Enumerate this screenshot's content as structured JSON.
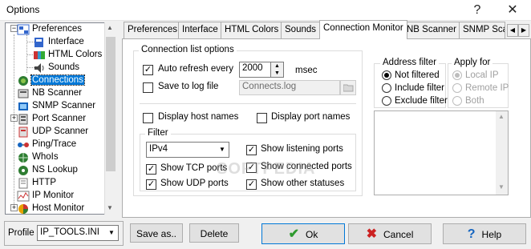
{
  "window": {
    "title": "Options",
    "help_glyph": "?",
    "close_glyph": "✕"
  },
  "tree": {
    "items": [
      {
        "label": "Preferences",
        "icon": "preferences-icon",
        "icon_color": "#3366cc"
      },
      {
        "label": "Interface",
        "icon": "interface-icon",
        "icon_color": "#3366cc"
      },
      {
        "label": "HTML Colors",
        "icon": "html-colors-icon",
        "icon_color": "#cc3333"
      },
      {
        "label": "Sounds",
        "icon": "sounds-icon",
        "icon_color": "#444444"
      },
      {
        "label": "Connections",
        "icon": "connections-icon",
        "icon_color": "#2e7d32"
      },
      {
        "label": "NB Scanner",
        "icon": "nb-scanner-icon",
        "icon_color": "#555555"
      },
      {
        "label": "SNMP Scanner",
        "icon": "snmp-scanner-icon",
        "icon_color": "#1565c0"
      },
      {
        "label": "Port Scanner",
        "icon": "port-scanner-icon",
        "icon_color": "#555555"
      },
      {
        "label": "UDP Scanner",
        "icon": "udp-scanner-icon",
        "icon_color": "#cc3333"
      },
      {
        "label": "Ping/Trace",
        "icon": "ping-trace-icon",
        "icon_color": "#1565c0"
      },
      {
        "label": "WhoIs",
        "icon": "whois-icon",
        "icon_color": "#2e7d32"
      },
      {
        "label": "NS Lookup",
        "icon": "ns-lookup-icon",
        "icon_color": "#2e7d32"
      },
      {
        "label": "HTTP",
        "icon": "http-icon",
        "icon_color": "#777777"
      },
      {
        "label": "IP Monitor",
        "icon": "ip-monitor-icon",
        "icon_color": "#cc3333"
      },
      {
        "label": "Host Monitor",
        "icon": "host-monitor-icon",
        "icon_color": "#e6a100"
      }
    ],
    "selected": "Connections"
  },
  "tabs": [
    {
      "label": "Preferences"
    },
    {
      "label": "Interface"
    },
    {
      "label": "HTML Colors"
    },
    {
      "label": "Sounds"
    },
    {
      "label": "Connection Monitor"
    },
    {
      "label": "NB Scanner"
    },
    {
      "label": "SNMP Sca"
    }
  ],
  "active_tab": "Connection Monitor",
  "panel": {
    "connection_list": {
      "title": "Connection list options",
      "auto_refresh": {
        "label": "Auto refresh every",
        "checked": true,
        "value": "2000",
        "unit": "msec"
      },
      "save_to_log": {
        "label": "Save to log file",
        "checked": false,
        "value": "Connects.log"
      },
      "display_host_names": {
        "label": "Display host names",
        "checked": false
      },
      "display_port_names": {
        "label": "Display port names",
        "checked": false
      }
    },
    "filter": {
      "title": "Filter",
      "protocol_value": "IPv4",
      "show_tcp": {
        "label": "Show TCP ports",
        "checked": true
      },
      "show_udp": {
        "label": "Show UDP ports",
        "checked": true
      },
      "show_listening": {
        "label": "Show listening ports",
        "checked": true
      },
      "show_connected": {
        "label": "Show connected ports",
        "checked": true
      },
      "show_other": {
        "label": "Show other statuses",
        "checked": true
      }
    },
    "address_filter": {
      "title": "Address filter",
      "options": [
        {
          "label": "Not filtered",
          "selected": true
        },
        {
          "label": "Include filter",
          "selected": false
        },
        {
          "label": "Exclude filter",
          "selected": false
        }
      ]
    },
    "apply_for": {
      "title": "Apply for",
      "options": [
        {
          "label": "Local IP",
          "selected": true
        },
        {
          "label": "Remote IP",
          "selected": false
        },
        {
          "label": "Both",
          "selected": false
        }
      ]
    }
  },
  "bottom": {
    "profile_label": "Profile",
    "profile_value": "IP_TOOLS.INI",
    "save_as_label": "Save as..",
    "delete_label": "Delete",
    "ok_label": "Ok",
    "cancel_label": "Cancel",
    "help_label": "Help"
  },
  "watermark": "SOFTPEDIA"
}
